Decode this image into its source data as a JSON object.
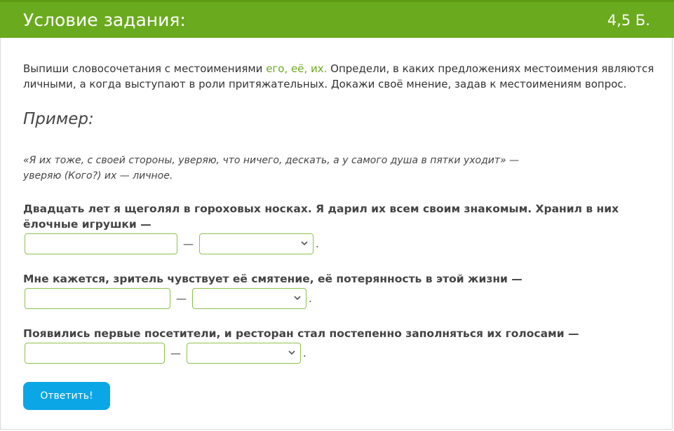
{
  "header": {
    "title": "Условие задания:",
    "points": "4,5 Б."
  },
  "instruction": {
    "before": "Выпиши словосочетания с местоимениями ",
    "pronouns": "его, её, их.",
    "after": " Определи, в каких предложениях местоимения  являются личными, а когда выступают в роли притяжательных. Докажи своё мнение, задав к местоимениям вопрос."
  },
  "example": {
    "heading": "Пример:",
    "line1": "«Я их тоже, с своей стороны, уверяю, что ничего, дескать, а у самого душа в пятки уходит» —",
    "line2": "уверяю (Кого?) их — личное."
  },
  "tasks": [
    {
      "sentence": "Двадцать лет я щеголял в гороховых носках. Я дарил их всем своим знакомым. Хранил в них ёлочные игрушки —",
      "input_value": "",
      "select_value": "",
      "dash": "—",
      "period": "."
    },
    {
      "sentence": "Мне кажется, зритель чувствует её смятение, её потерянность в этой жизни —",
      "input_value": "",
      "select_value": "",
      "dash": "—",
      "period": "."
    },
    {
      "sentence": "Появились первые посетители, и ресторан стал постепенно заполняться их голосами —",
      "input_value": "",
      "select_value": "",
      "dash": "—",
      "period": "."
    }
  ],
  "submit_label": "Ответить!",
  "colors": {
    "header_bg": "#6aaa1e",
    "accent_green": "#6aaa1e",
    "input_border": "#8dc24a",
    "button_bg": "#0ba6e6"
  },
  "icons": {
    "dropdown": "chevron-down-icon"
  }
}
